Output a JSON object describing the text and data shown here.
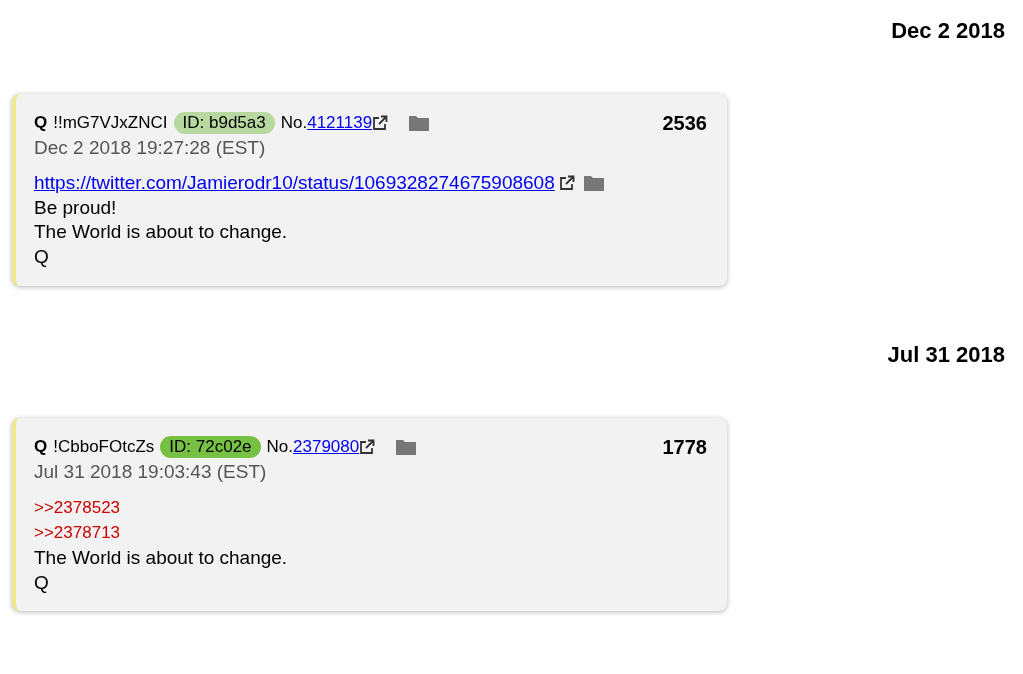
{
  "groups": [
    {
      "date": "Dec 2 2018",
      "post": {
        "author": "Q",
        "tripcode": "!!mG7VJxZNCI",
        "id_label": "ID: b9d5a3",
        "color": "#b7d89f",
        "no_label": "No.",
        "number": "4121139",
        "count": "2536",
        "timestamp": "Dec 2 2018 19:27:28 (EST)",
        "lines": [
          {
            "kind": "link",
            "text": "https://twitter.com/Jamierodr10/status/1069328274675908608"
          },
          {
            "kind": "text",
            "text": "Be proud!"
          },
          {
            "kind": "text",
            "text": "The World is about to change."
          },
          {
            "kind": "text",
            "text": "Q"
          }
        ]
      }
    },
    {
      "date": "Jul 31 2018",
      "post": {
        "author": "Q",
        "tripcode": "!CbboFOtcZs",
        "id_label": "ID: 72c02e",
        "color": "#76c043",
        "no_label": "No.",
        "number": "2379080",
        "count": "1778",
        "timestamp": "Jul 31 2018 19:03:43 (EST)",
        "lines": [
          {
            "kind": "reference",
            "text": ">>2378523"
          },
          {
            "kind": "reference",
            "text": ">>2378713"
          },
          {
            "kind": "text",
            "text": "The World is about to change."
          },
          {
            "kind": "text",
            "text": "Q"
          }
        ]
      }
    }
  ]
}
